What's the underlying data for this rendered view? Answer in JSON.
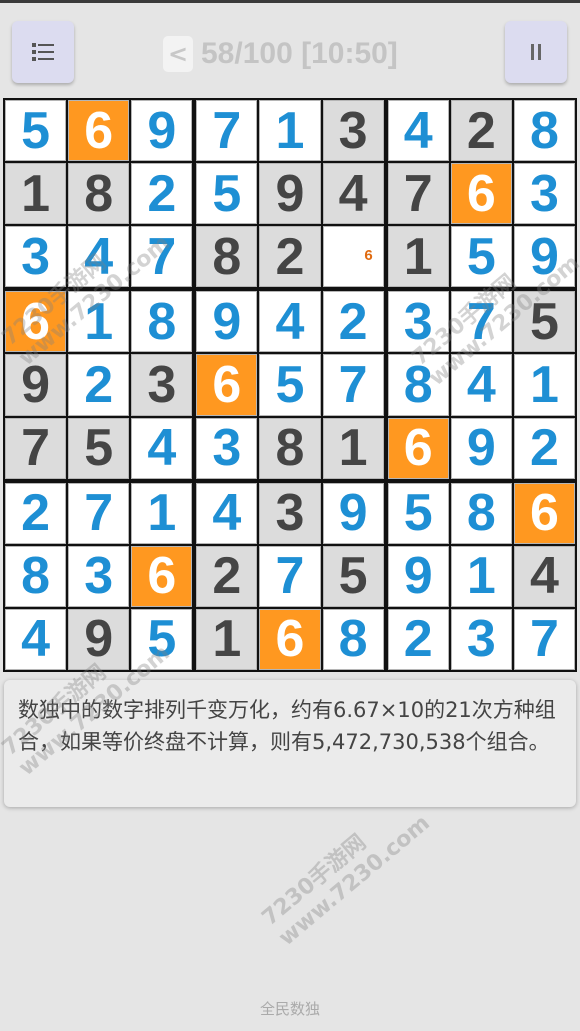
{
  "header": {
    "menu_icon": "menu-icon",
    "back_label": "<",
    "progress": "58/100 [10:50]",
    "pause_icon": "pause-icon"
  },
  "board": {
    "rows": [
      [
        "5",
        "6",
        "9",
        "7",
        "1",
        "3",
        "4",
        "2",
        "8"
      ],
      [
        "1",
        "8",
        "2",
        "5",
        "9",
        "4",
        "7",
        "6",
        "3"
      ],
      [
        "3",
        "4",
        "7",
        "8",
        "2",
        "",
        "1",
        "5",
        "9"
      ],
      [
        "6",
        "1",
        "8",
        "9",
        "4",
        "2",
        "3",
        "7",
        "5"
      ],
      [
        "9",
        "2",
        "3",
        "6",
        "5",
        "7",
        "8",
        "4",
        "1"
      ],
      [
        "7",
        "5",
        "4",
        "3",
        "8",
        "1",
        "6",
        "9",
        "2"
      ],
      [
        "2",
        "7",
        "1",
        "4",
        "3",
        "9",
        "5",
        "8",
        "6"
      ],
      [
        "8",
        "3",
        "6",
        "2",
        "7",
        "5",
        "9",
        "1",
        "4"
      ],
      [
        "4",
        "9",
        "5",
        "1",
        "6",
        "8",
        "2",
        "3",
        "7"
      ]
    ],
    "cell_types": [
      [
        "u",
        "h",
        "u",
        "u",
        "u",
        "g",
        "u",
        "g",
        "u"
      ],
      [
        "g",
        "g",
        "u",
        "u",
        "g",
        "g",
        "g",
        "h",
        "u"
      ],
      [
        "u",
        "u",
        "u",
        "g",
        "g",
        "e",
        "g",
        "u",
        "u"
      ],
      [
        "h",
        "u",
        "u",
        "u",
        "u",
        "u",
        "u",
        "u",
        "g"
      ],
      [
        "g",
        "u",
        "g",
        "h",
        "u",
        "u",
        "u",
        "u",
        "u"
      ],
      [
        "g",
        "g",
        "u",
        "u",
        "g",
        "g",
        "h",
        "u",
        "u"
      ],
      [
        "u",
        "u",
        "u",
        "u",
        "g",
        "u",
        "u",
        "u",
        "h"
      ],
      [
        "u",
        "u",
        "h",
        "g",
        "u",
        "g",
        "u",
        "u",
        "g"
      ],
      [
        "u",
        "g",
        "u",
        "g",
        "h",
        "u",
        "u",
        "u",
        "u"
      ]
    ],
    "notes": [
      {
        "row": 2,
        "col": 5,
        "value": "6"
      }
    ],
    "colors": {
      "given_bg": "#dcdcdc",
      "given_text": "#454545",
      "user_text": "#1e8fd4",
      "highlight_bg": "#ff9820",
      "note_text": "#e06b10",
      "border": "#111111"
    }
  },
  "info": {
    "text": "数独中的数字排列千变万化，约有6.67×10的21次方种组合，如果等价终盘不计算，则有5,472,730,538个组合。"
  },
  "footer": {
    "text": "全民数独"
  },
  "watermarks": [
    "7230手游网\nwww.7230.com"
  ]
}
